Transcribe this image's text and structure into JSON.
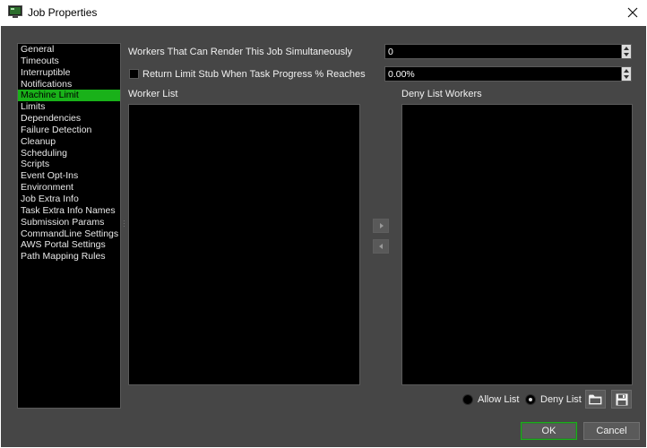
{
  "window": {
    "title": "Job Properties",
    "app_icon": "monitor-app-icon",
    "close_icon": "close-icon"
  },
  "nav": {
    "items": [
      "General",
      "Timeouts",
      "Interruptible",
      "Notifications",
      "Machine Limit",
      "Limits",
      "Dependencies",
      "Failure Detection",
      "Cleanup",
      "Scheduling",
      "Scripts",
      "Event Opt-Ins",
      "Environment",
      "Job Extra Info",
      "Task Extra Info Names",
      "Submission Params",
      "CommandLine Settings",
      "AWS Portal Settings",
      "Path Mapping Rules"
    ],
    "selected": "Machine Limit"
  },
  "form": {
    "workers_label": "Workers That Can Render This Job Simultaneously",
    "workers_value": "0",
    "return_limit_label": "Return Limit Stub When Task Progress % Reaches",
    "return_limit_checked": false,
    "return_limit_value": "0.00%"
  },
  "lists": {
    "worker_list_label": "Worker List",
    "deny_list_label": "Deny List Workers",
    "worker_list_items": [],
    "deny_list_items": []
  },
  "mode": {
    "allow_label": "Allow List",
    "deny_label": "Deny List",
    "selected": "Deny List"
  },
  "buttons": {
    "ok": "OK",
    "cancel": "Cancel"
  },
  "colors": {
    "selection": "#19b119",
    "background": "#464646",
    "field": "#000000"
  }
}
